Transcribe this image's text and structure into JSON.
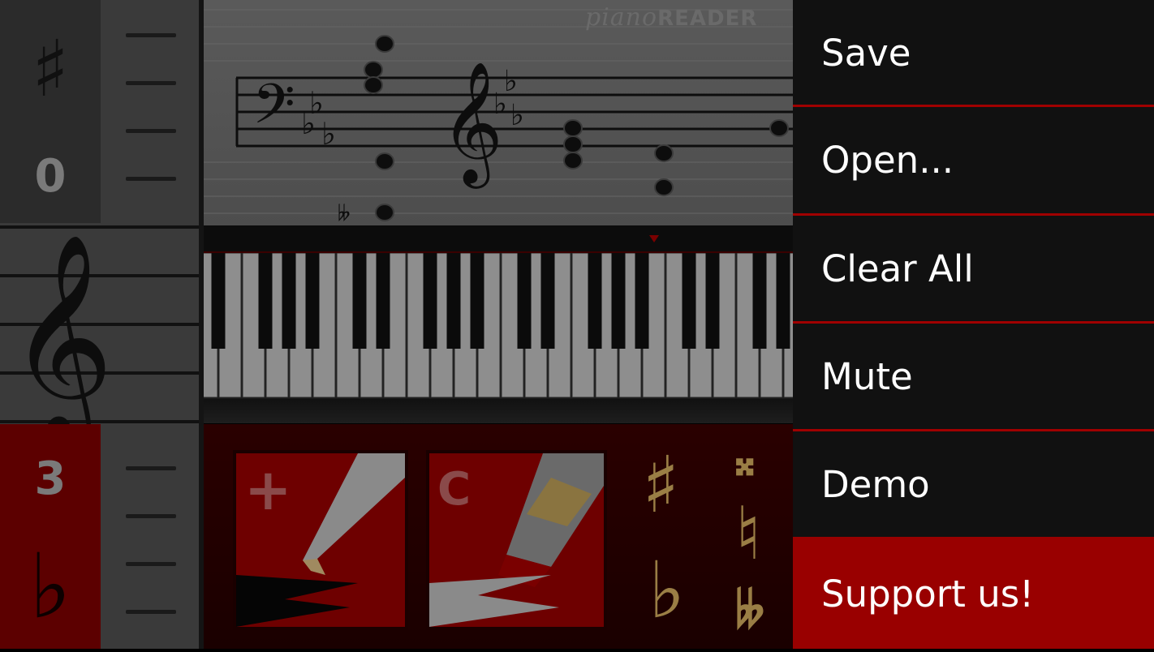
{
  "app": {
    "logo_text_script": "piano",
    "logo_text_bold": "READER"
  },
  "left_panel": {
    "sharp_symbol": "♯",
    "sharp_count": "0",
    "flat_count": "3",
    "flat_symbol": "♭"
  },
  "tools": {
    "add_symbol": "+",
    "clear_symbol": "C",
    "accidentals": [
      "♯",
      "♭",
      "𝄪",
      "♮",
      "𝄫"
    ]
  },
  "menu": {
    "items": [
      {
        "label": "Save"
      },
      {
        "label": "Open..."
      },
      {
        "label": "Clear All"
      },
      {
        "label": "Mute"
      },
      {
        "label": "Demo"
      },
      {
        "label": "Support us!"
      }
    ]
  },
  "colors": {
    "accent": "#990000",
    "divider": "#a00000",
    "menu_bg": "#111111",
    "gold": "#9a7e45"
  }
}
